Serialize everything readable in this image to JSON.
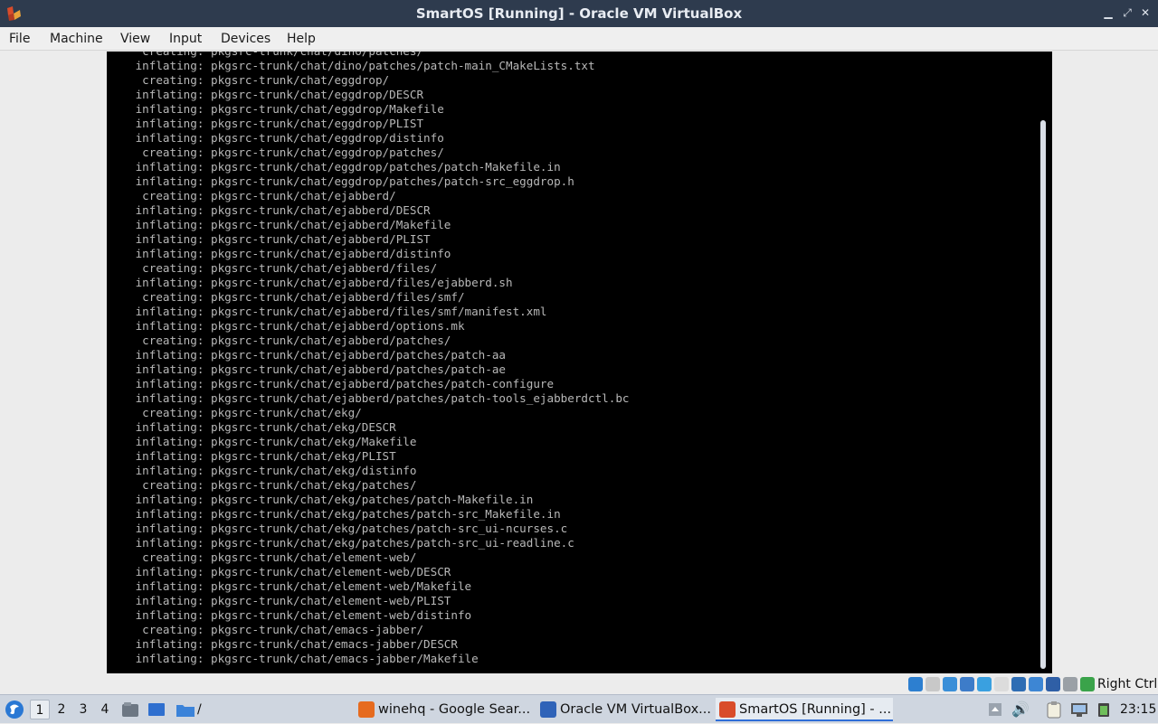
{
  "window": {
    "title": "SmartOS [Running] - Oracle VM VirtualBox",
    "controls": {
      "minimize": "▁",
      "maximize": "⤢",
      "close": "✕"
    }
  },
  "menu": {
    "items": [
      "File",
      "Machine",
      "View",
      "Input",
      "Devices",
      "Help"
    ]
  },
  "console": {
    "lines": [
      "  creating: pkgsrc-trunk/chat/dino/patches/",
      " inflating: pkgsrc-trunk/chat/dino/patches/patch-main_CMakeLists.txt",
      "  creating: pkgsrc-trunk/chat/eggdrop/",
      " inflating: pkgsrc-trunk/chat/eggdrop/DESCR",
      " inflating: pkgsrc-trunk/chat/eggdrop/Makefile",
      " inflating: pkgsrc-trunk/chat/eggdrop/PLIST",
      " inflating: pkgsrc-trunk/chat/eggdrop/distinfo",
      "  creating: pkgsrc-trunk/chat/eggdrop/patches/",
      " inflating: pkgsrc-trunk/chat/eggdrop/patches/patch-Makefile.in",
      " inflating: pkgsrc-trunk/chat/eggdrop/patches/patch-src_eggdrop.h",
      "  creating: pkgsrc-trunk/chat/ejabberd/",
      " inflating: pkgsrc-trunk/chat/ejabberd/DESCR",
      " inflating: pkgsrc-trunk/chat/ejabberd/Makefile",
      " inflating: pkgsrc-trunk/chat/ejabberd/PLIST",
      " inflating: pkgsrc-trunk/chat/ejabberd/distinfo",
      "  creating: pkgsrc-trunk/chat/ejabberd/files/",
      " inflating: pkgsrc-trunk/chat/ejabberd/files/ejabberd.sh",
      "  creating: pkgsrc-trunk/chat/ejabberd/files/smf/",
      " inflating: pkgsrc-trunk/chat/ejabberd/files/smf/manifest.xml",
      " inflating: pkgsrc-trunk/chat/ejabberd/options.mk",
      "  creating: pkgsrc-trunk/chat/ejabberd/patches/",
      " inflating: pkgsrc-trunk/chat/ejabberd/patches/patch-aa",
      " inflating: pkgsrc-trunk/chat/ejabberd/patches/patch-ae",
      " inflating: pkgsrc-trunk/chat/ejabberd/patches/patch-configure",
      " inflating: pkgsrc-trunk/chat/ejabberd/patches/patch-tools_ejabberdctl.bc",
      "  creating: pkgsrc-trunk/chat/ekg/",
      " inflating: pkgsrc-trunk/chat/ekg/DESCR",
      " inflating: pkgsrc-trunk/chat/ekg/Makefile",
      " inflating: pkgsrc-trunk/chat/ekg/PLIST",
      " inflating: pkgsrc-trunk/chat/ekg/distinfo",
      "  creating: pkgsrc-trunk/chat/ekg/patches/",
      " inflating: pkgsrc-trunk/chat/ekg/patches/patch-Makefile.in",
      " inflating: pkgsrc-trunk/chat/ekg/patches/patch-src_Makefile.in",
      " inflating: pkgsrc-trunk/chat/ekg/patches/patch-src_ui-ncurses.c",
      " inflating: pkgsrc-trunk/chat/ekg/patches/patch-src_ui-readline.c",
      "  creating: pkgsrc-trunk/chat/element-web/",
      " inflating: pkgsrc-trunk/chat/element-web/DESCR",
      " inflating: pkgsrc-trunk/chat/element-web/Makefile",
      " inflating: pkgsrc-trunk/chat/element-web/PLIST",
      " inflating: pkgsrc-trunk/chat/element-web/distinfo",
      "  creating: pkgsrc-trunk/chat/emacs-jabber/",
      " inflating: pkgsrc-trunk/chat/emacs-jabber/DESCR",
      " inflating: pkgsrc-trunk/chat/emacs-jabber/Makefile"
    ]
  },
  "statusbar": {
    "icons": [
      {
        "name": "hard-disk-icon",
        "color": "#2d7fd0"
      },
      {
        "name": "optical-drive-icon",
        "color": "#c8c8c8"
      },
      {
        "name": "audio-icon",
        "color": "#3a8fd8"
      },
      {
        "name": "network-icon",
        "color": "#3d7cc9"
      },
      {
        "name": "usb-icon",
        "color": "#3aa0e0"
      },
      {
        "name": "shared-folders-icon",
        "color": "#dcdcdc"
      },
      {
        "name": "display-icon",
        "color": "#2e6db4"
      },
      {
        "name": "recording-icon",
        "color": "#3d86d4"
      },
      {
        "name": "virtualization-icon",
        "color": "#2f5fa6"
      },
      {
        "name": "mouse-integration-icon",
        "color": "#9aa0a6"
      },
      {
        "name": "keyboard-capture-icon",
        "color": "#3aa34a"
      }
    ],
    "host_key": "Right Ctrl"
  },
  "taskbar": {
    "workspaces": [
      "1",
      "2",
      "3",
      "4"
    ],
    "active_workspace": "1",
    "folder_label": "/",
    "tasks": [
      {
        "label": "winehq - Google Sear...",
        "icon": "firefox-icon",
        "color": "#e66b1f",
        "active": false
      },
      {
        "label": "Oracle VM VirtualBox...",
        "icon": "virtualbox-manager-icon",
        "color": "#2f63b8",
        "active": false
      },
      {
        "label": "SmartOS [Running] - ...",
        "icon": "virtualbox-vm-icon",
        "color": "#d94c2a",
        "active": true
      }
    ],
    "clock": "23:15"
  },
  "colors": {
    "titlebar": "#2e3b4e",
    "console_bg": "#000000",
    "console_text": "#b8b8b8",
    "taskbar": "#cfd6e0",
    "accent": "#2f6ed8"
  }
}
